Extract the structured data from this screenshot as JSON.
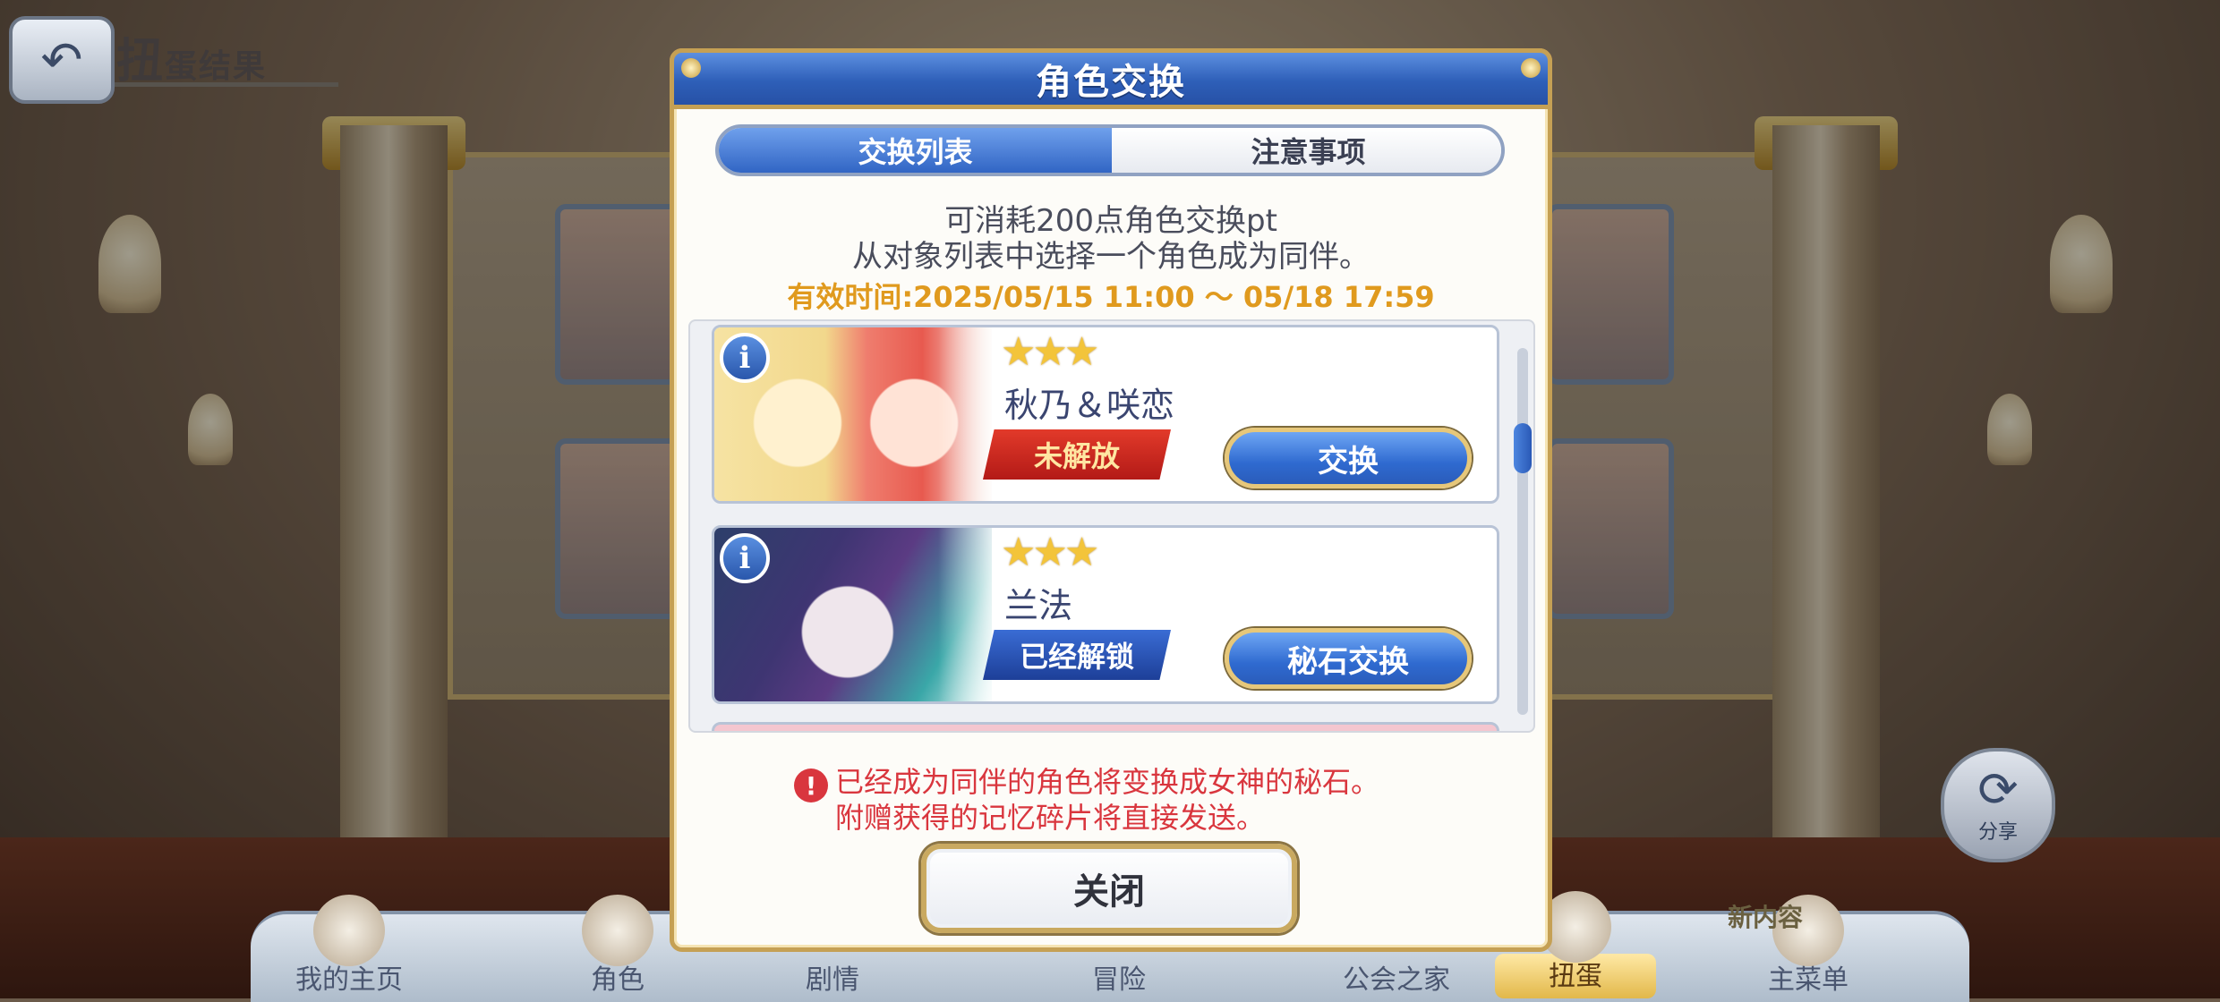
{
  "background": {
    "back_icon": "back-arrow-icon",
    "title_big": "扭",
    "title_small": "蛋结果",
    "share": {
      "icon": "share-icon",
      "label": "分享"
    },
    "bottom_nav": [
      {
        "label": "我的主页"
      },
      {
        "label": "角色"
      },
      {
        "label": "剧情"
      },
      {
        "label": "冒险"
      },
      {
        "label": "公会之家"
      },
      {
        "label": "扭蛋"
      },
      {
        "label": "主菜单"
      }
    ],
    "new_badge": "新内容"
  },
  "dialog": {
    "title": "角色交换",
    "tabs": [
      {
        "label": "交换列表",
        "active": true
      },
      {
        "label": "注意事项",
        "active": false
      }
    ],
    "description_line1": "可消耗200点角色交换pt",
    "description_line2": "从对象列表中选择一个角色成为同伴。",
    "valid_period": "有效时间:2025/05/15 11:00 ～ 05/18 17:59",
    "entries": [
      {
        "stars": "★★★",
        "star_count": 3,
        "name": "秋乃＆咲恋",
        "status": "未解放",
        "action": "交换",
        "info_icon": "info-icon"
      },
      {
        "stars": "★★★",
        "star_count": 3,
        "name": "兰法",
        "status": "已经解锁",
        "action": "秘石交换",
        "info_icon": "info-icon"
      }
    ],
    "warning_icon": "exclamation-icon",
    "warning_line1": "已经成为同伴的角色将变换成女神的秘石。",
    "warning_line2": "附赠获得的记忆碎片将直接发送。",
    "close_label": "关闭"
  },
  "colors": {
    "header_blue": "#2e5fb8",
    "gold_border": "#c5a054",
    "valid_orange": "#e09a1e",
    "warning_red": "#d9363e",
    "locked_red": "#c2241f",
    "unlocked_blue": "#1d3f98",
    "star_gold": "#f3c43a"
  }
}
